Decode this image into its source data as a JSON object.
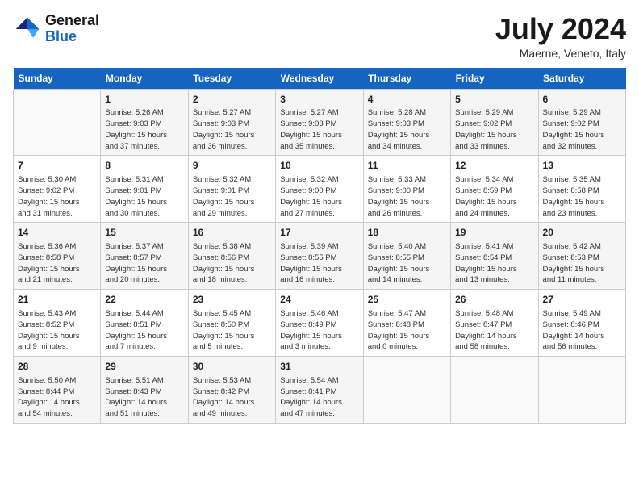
{
  "header": {
    "logo_general": "General",
    "logo_blue": "Blue",
    "month_year": "July 2024",
    "location": "Maerne, Veneto, Italy"
  },
  "calendar": {
    "weekdays": [
      "Sunday",
      "Monday",
      "Tuesday",
      "Wednesday",
      "Thursday",
      "Friday",
      "Saturday"
    ],
    "weeks": [
      [
        {
          "day": "",
          "info": ""
        },
        {
          "day": "1",
          "info": "Sunrise: 5:26 AM\nSunset: 9:03 PM\nDaylight: 15 hours\nand 37 minutes."
        },
        {
          "day": "2",
          "info": "Sunrise: 5:27 AM\nSunset: 9:03 PM\nDaylight: 15 hours\nand 36 minutes."
        },
        {
          "day": "3",
          "info": "Sunrise: 5:27 AM\nSunset: 9:03 PM\nDaylight: 15 hours\nand 35 minutes."
        },
        {
          "day": "4",
          "info": "Sunrise: 5:28 AM\nSunset: 9:03 PM\nDaylight: 15 hours\nand 34 minutes."
        },
        {
          "day": "5",
          "info": "Sunrise: 5:29 AM\nSunset: 9:02 PM\nDaylight: 15 hours\nand 33 minutes."
        },
        {
          "day": "6",
          "info": "Sunrise: 5:29 AM\nSunset: 9:02 PM\nDaylight: 15 hours\nand 32 minutes."
        }
      ],
      [
        {
          "day": "7",
          "info": "Sunrise: 5:30 AM\nSunset: 9:02 PM\nDaylight: 15 hours\nand 31 minutes."
        },
        {
          "day": "8",
          "info": "Sunrise: 5:31 AM\nSunset: 9:01 PM\nDaylight: 15 hours\nand 30 minutes."
        },
        {
          "day": "9",
          "info": "Sunrise: 5:32 AM\nSunset: 9:01 PM\nDaylight: 15 hours\nand 29 minutes."
        },
        {
          "day": "10",
          "info": "Sunrise: 5:32 AM\nSunset: 9:00 PM\nDaylight: 15 hours\nand 27 minutes."
        },
        {
          "day": "11",
          "info": "Sunrise: 5:33 AM\nSunset: 9:00 PM\nDaylight: 15 hours\nand 26 minutes."
        },
        {
          "day": "12",
          "info": "Sunrise: 5:34 AM\nSunset: 8:59 PM\nDaylight: 15 hours\nand 24 minutes."
        },
        {
          "day": "13",
          "info": "Sunrise: 5:35 AM\nSunset: 8:58 PM\nDaylight: 15 hours\nand 23 minutes."
        }
      ],
      [
        {
          "day": "14",
          "info": "Sunrise: 5:36 AM\nSunset: 8:58 PM\nDaylight: 15 hours\nand 21 minutes."
        },
        {
          "day": "15",
          "info": "Sunrise: 5:37 AM\nSunset: 8:57 PM\nDaylight: 15 hours\nand 20 minutes."
        },
        {
          "day": "16",
          "info": "Sunrise: 5:38 AM\nSunset: 8:56 PM\nDaylight: 15 hours\nand 18 minutes."
        },
        {
          "day": "17",
          "info": "Sunrise: 5:39 AM\nSunset: 8:55 PM\nDaylight: 15 hours\nand 16 minutes."
        },
        {
          "day": "18",
          "info": "Sunrise: 5:40 AM\nSunset: 8:55 PM\nDaylight: 15 hours\nand 14 minutes."
        },
        {
          "day": "19",
          "info": "Sunrise: 5:41 AM\nSunset: 8:54 PM\nDaylight: 15 hours\nand 13 minutes."
        },
        {
          "day": "20",
          "info": "Sunrise: 5:42 AM\nSunset: 8:53 PM\nDaylight: 15 hours\nand 11 minutes."
        }
      ],
      [
        {
          "day": "21",
          "info": "Sunrise: 5:43 AM\nSunset: 8:52 PM\nDaylight: 15 hours\nand 9 minutes."
        },
        {
          "day": "22",
          "info": "Sunrise: 5:44 AM\nSunset: 8:51 PM\nDaylight: 15 hours\nand 7 minutes."
        },
        {
          "day": "23",
          "info": "Sunrise: 5:45 AM\nSunset: 8:50 PM\nDaylight: 15 hours\nand 5 minutes."
        },
        {
          "day": "24",
          "info": "Sunrise: 5:46 AM\nSunset: 8:49 PM\nDaylight: 15 hours\nand 3 minutes."
        },
        {
          "day": "25",
          "info": "Sunrise: 5:47 AM\nSunset: 8:48 PM\nDaylight: 15 hours\nand 0 minutes."
        },
        {
          "day": "26",
          "info": "Sunrise: 5:48 AM\nSunset: 8:47 PM\nDaylight: 14 hours\nand 58 minutes."
        },
        {
          "day": "27",
          "info": "Sunrise: 5:49 AM\nSunset: 8:46 PM\nDaylight: 14 hours\nand 56 minutes."
        }
      ],
      [
        {
          "day": "28",
          "info": "Sunrise: 5:50 AM\nSunset: 8:44 PM\nDaylight: 14 hours\nand 54 minutes."
        },
        {
          "day": "29",
          "info": "Sunrise: 5:51 AM\nSunset: 8:43 PM\nDaylight: 14 hours\nand 51 minutes."
        },
        {
          "day": "30",
          "info": "Sunrise: 5:53 AM\nSunset: 8:42 PM\nDaylight: 14 hours\nand 49 minutes."
        },
        {
          "day": "31",
          "info": "Sunrise: 5:54 AM\nSunset: 8:41 PM\nDaylight: 14 hours\nand 47 minutes."
        },
        {
          "day": "",
          "info": ""
        },
        {
          "day": "",
          "info": ""
        },
        {
          "day": "",
          "info": ""
        }
      ]
    ]
  }
}
